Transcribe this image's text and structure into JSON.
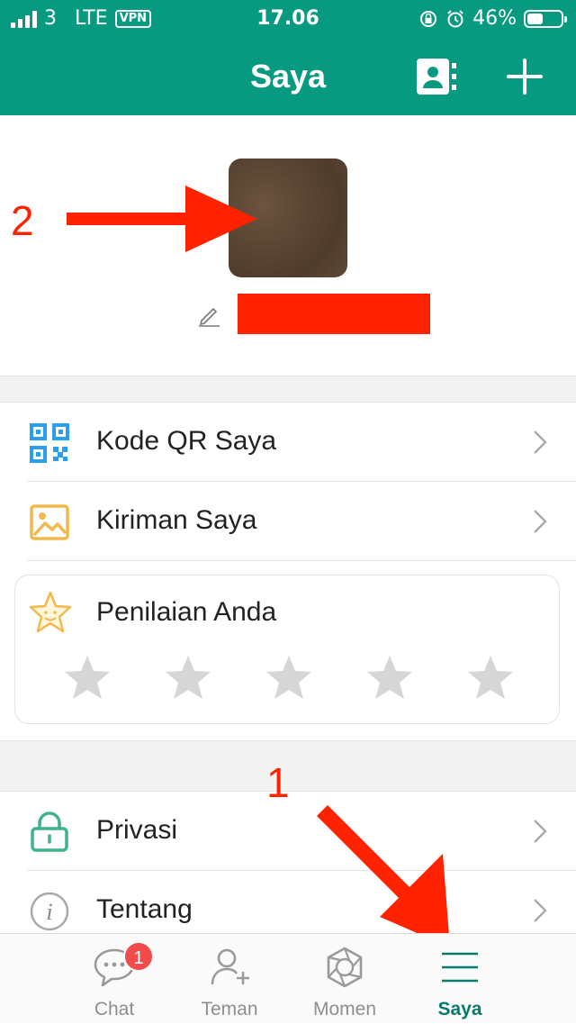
{
  "status_bar": {
    "carrier": "3",
    "network": "LTE",
    "vpn": "VPN",
    "time": "17.06",
    "battery": "46%",
    "battery_level": 0.46
  },
  "nav": {
    "title": "Saya"
  },
  "annotations": {
    "marker_2": "2",
    "marker_1": "1"
  },
  "menu": {
    "qr": "Kode QR Saya",
    "posts": "Kiriman Saya",
    "rating_title": "Penilaian Anda",
    "rating_stars_total": 5,
    "rating_stars_filled": 0,
    "privacy": "Privasi",
    "about": "Tentang"
  },
  "tabs": [
    {
      "label": "Chat",
      "badge": "1",
      "icon": "chat-bubble-icon"
    },
    {
      "label": "Teman",
      "icon": "add-friend-icon"
    },
    {
      "label": "Momen",
      "icon": "aperture-icon"
    },
    {
      "label": "Saya",
      "icon": "menu-lines-icon",
      "active": true
    }
  ],
  "colors": {
    "brand": "#079a80",
    "annotation": "#ff2200",
    "active_tab": "#0c7a6a",
    "badge": "#f24b4b"
  }
}
